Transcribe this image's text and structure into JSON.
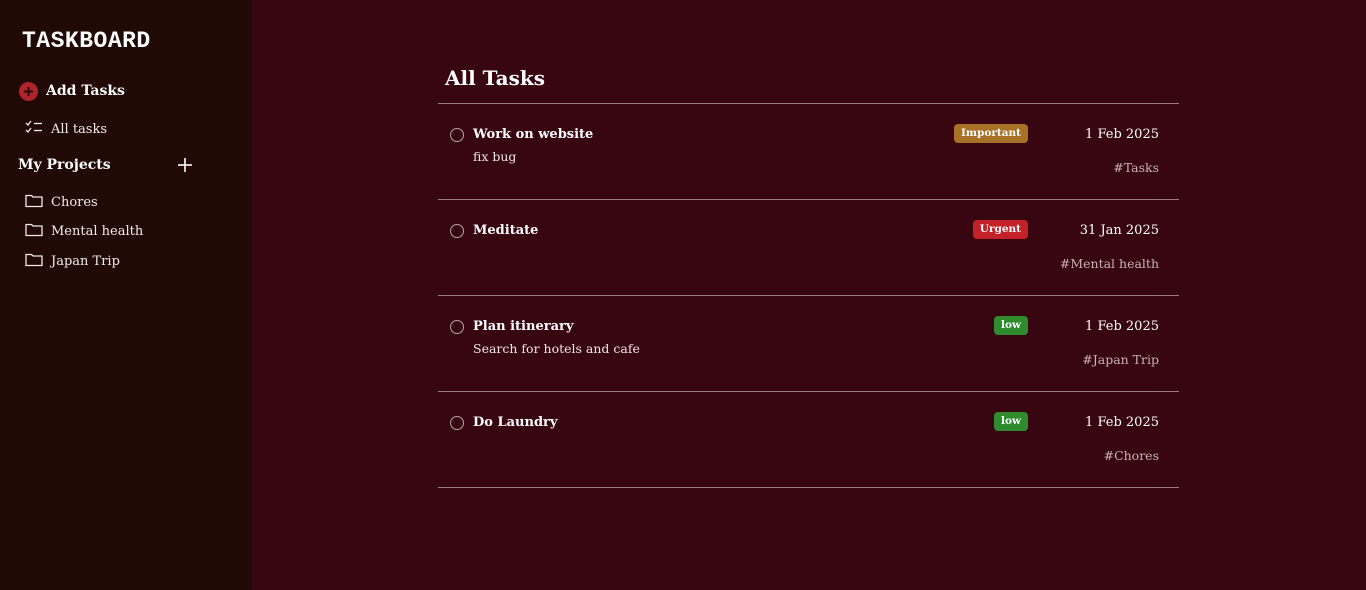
{
  "app": {
    "title": "TASKBOARD"
  },
  "sidebar": {
    "add_tasks_label": "Add Tasks",
    "all_tasks_label": "All tasks",
    "projects_title": "My Projects",
    "projects": [
      {
        "label": "Chores"
      },
      {
        "label": "Mental health"
      },
      {
        "label": "Japan Trip"
      }
    ]
  },
  "main": {
    "title": "All Tasks",
    "tasks": [
      {
        "name": "Work on website",
        "description": "fix bug",
        "priority": "Important",
        "priority_color": "#a87126",
        "date": "1 Feb 2025",
        "tag": "#Tasks"
      },
      {
        "name": "Meditate",
        "description": "",
        "priority": "Urgent",
        "priority_color": "#c42027",
        "date": "31 Jan 2025",
        "tag": "#Mental health"
      },
      {
        "name": "Plan itinerary",
        "description": "Search for hotels and cafe",
        "priority": "low",
        "priority_color": "#2e8b2e",
        "date": "1 Feb 2025",
        "tag": "#Japan Trip"
      },
      {
        "name": "Do Laundry",
        "description": "",
        "priority": "low",
        "priority_color": "#2e8b2e",
        "date": "1 Feb 2025",
        "tag": "#Chores"
      }
    ]
  },
  "colors": {
    "sidebar_bg": "#210a06",
    "main_bg": "#380610",
    "accent": "#b0232b"
  }
}
